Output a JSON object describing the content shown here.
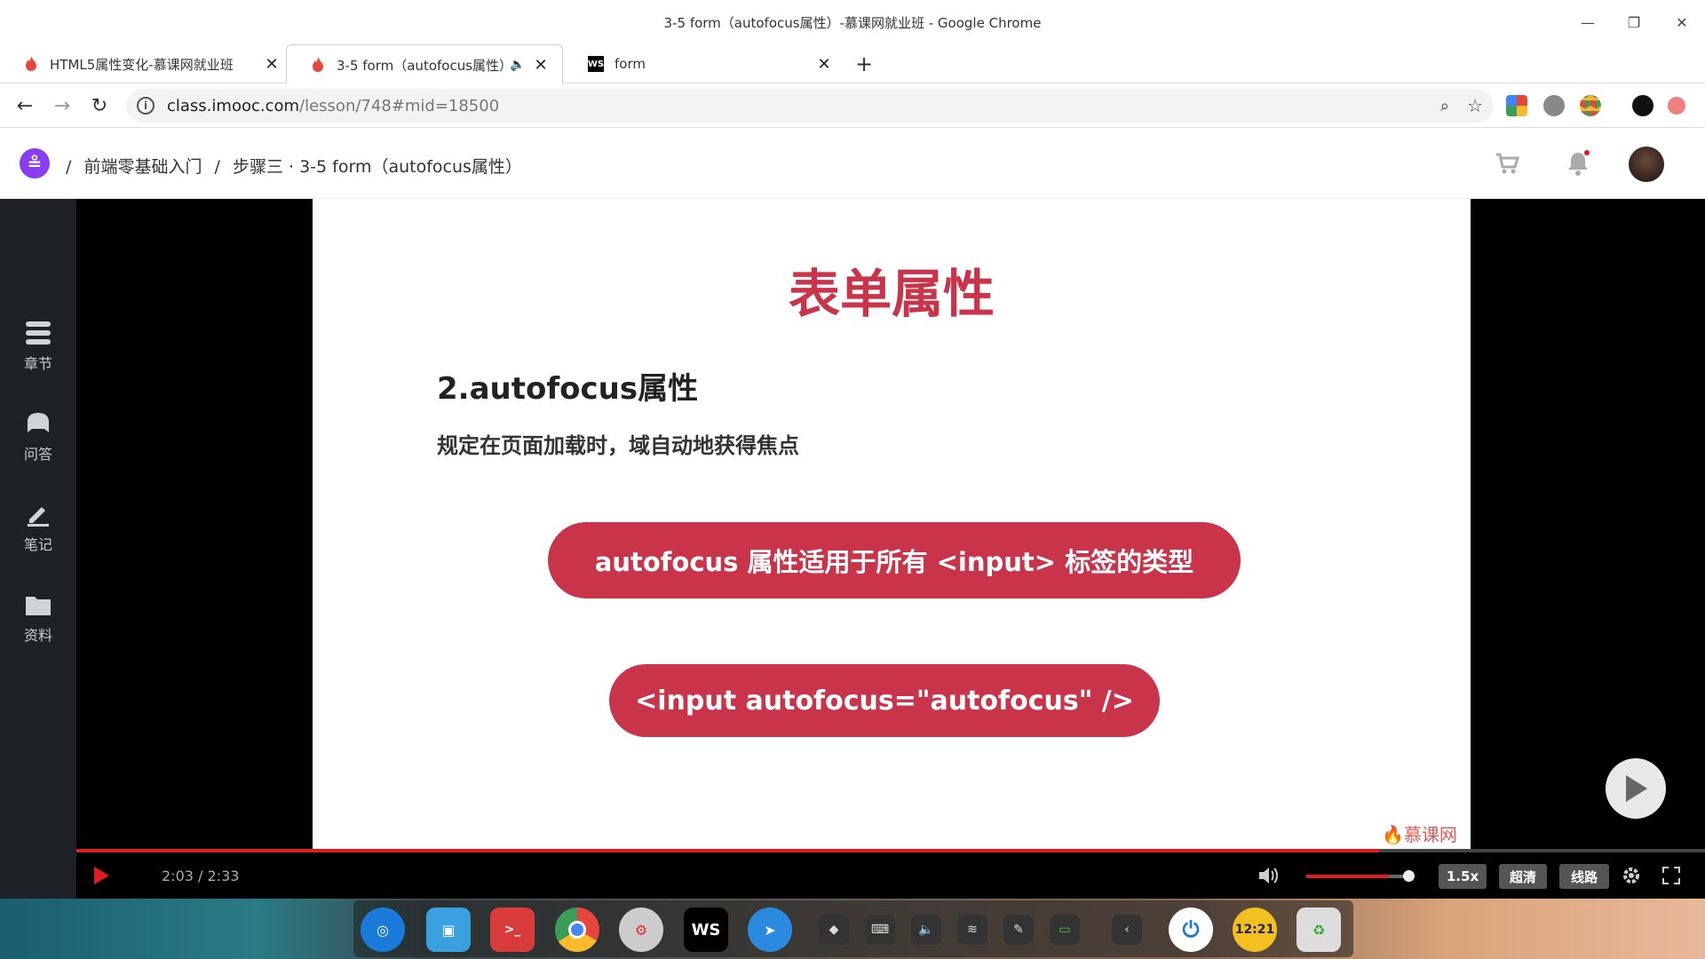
{
  "window": {
    "title": "3-5 form（autofocus属性）-慕课网就业班 - Google Chrome"
  },
  "tabs": [
    {
      "label": "HTML5属性变化-慕课网就业班",
      "icon": "flame-icon",
      "active": false
    },
    {
      "label": "3-5 form（autofocus属性）",
      "icon": "flame-icon",
      "active": true,
      "muted_icon": "speaker-icon"
    },
    {
      "label": "form",
      "icon": "webstorm-icon",
      "active": false
    }
  ],
  "address": {
    "host": "class.imooc.com",
    "path": "/lesson/748#mid=18500"
  },
  "site": {
    "breadcrumb": [
      "前端零基础入门",
      "步骤三 · 3-5 form（autofocus属性）"
    ],
    "separator": "/"
  },
  "sidebar": {
    "items": [
      {
        "label": "章节",
        "icon": "list-icon"
      },
      {
        "label": "问答",
        "icon": "chat-icon"
      },
      {
        "label": "笔记",
        "icon": "pencil-icon"
      },
      {
        "label": "资料",
        "icon": "folder-icon"
      }
    ]
  },
  "slide": {
    "title": "表单属性",
    "subtitle": "2.autofocus属性",
    "description": "规定在页面加载时，域自动地获得焦点",
    "pill1": "autofocus 属性适用于所有 <input> 标签的类型",
    "pill2": "<input autofocus=\"autofocus\" />",
    "watermark": "慕课网"
  },
  "player": {
    "time": "2:03 / 2:33",
    "progress": 0.8,
    "volume": 0.8,
    "speed": "1.5x",
    "quality": "超清",
    "route": "线路"
  },
  "colors": {
    "accent": "#c9344a",
    "progress": "#e01b24"
  }
}
